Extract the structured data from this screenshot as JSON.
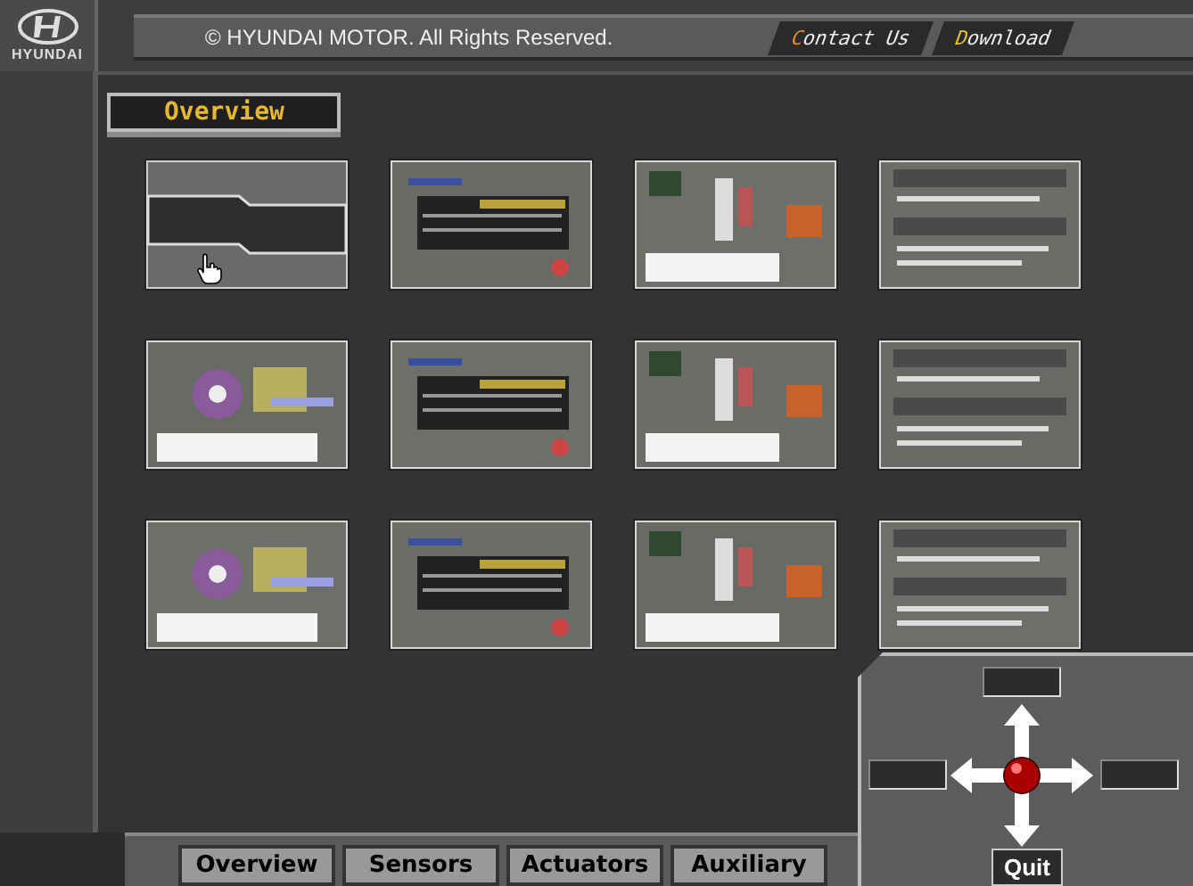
{
  "logo": {
    "text": "HYUNDAI"
  },
  "header": {
    "copyright": "© HYUNDAI MOTOR. All Rights Reserved.",
    "links": [
      {
        "label": "Contact Us"
      },
      {
        "label": "Download"
      }
    ]
  },
  "section_title": "Overview",
  "thumbnails": [
    {
      "kind": "blank"
    },
    {
      "kind": "picture"
    },
    {
      "kind": "picture"
    },
    {
      "kind": "picture"
    },
    {
      "kind": "picture"
    },
    {
      "kind": "picture"
    },
    {
      "kind": "picture"
    },
    {
      "kind": "picture"
    },
    {
      "kind": "picture"
    },
    {
      "kind": "picture"
    },
    {
      "kind": "picture"
    },
    {
      "kind": "picture"
    }
  ],
  "tabs": [
    {
      "label": "Overview",
      "selected": false
    },
    {
      "label": "Sensors",
      "selected": false
    },
    {
      "label": "Actuators",
      "selected": false
    },
    {
      "label": "Auxiliary",
      "selected": false
    }
  ],
  "quit_button": "Quit"
}
